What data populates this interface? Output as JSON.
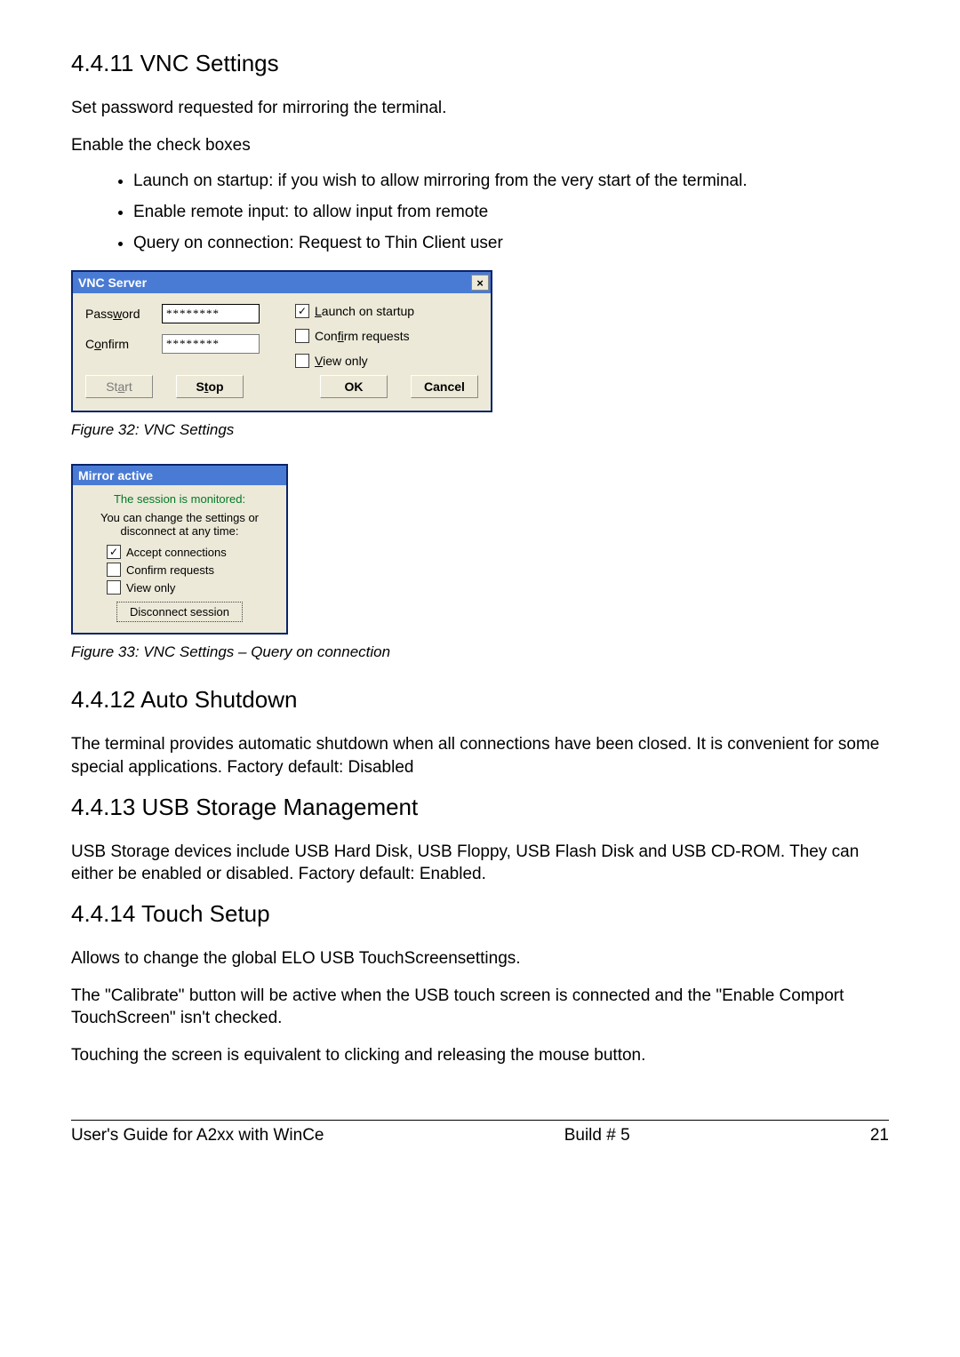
{
  "s1": {
    "heading": "4.4.11 VNC Settings",
    "p1": "Set password requested for mirroring the terminal.",
    "p2": "Enable the check boxes",
    "bullets": [
      "Launch on startup:    if you wish to allow mirroring from the very start of the terminal.",
      "Enable remote input: to allow input from remote",
      "Query on connection: Request to Thin Client user"
    ]
  },
  "vnc": {
    "title": "VNC Server",
    "close": "×",
    "password_label": "Password",
    "confirm_label": "Confirm",
    "password_value": "********",
    "confirm_value": "********",
    "cb_launch": "Launch on startup",
    "cb_confirm": "Confirm requests",
    "cb_view": "View only",
    "btn_start": "Start",
    "btn_stop": "Stop",
    "btn_ok": "OK",
    "btn_cancel": "Cancel"
  },
  "cap1": "Figure 32: VNC Settings",
  "mirror": {
    "title": "Mirror active",
    "line1": "The session is monitored:",
    "line2": "You can change the settings or disconnect at any time:",
    "cb_accept": "Accept connections",
    "cb_confirm": "Confirm requests",
    "cb_view": "View only",
    "btn_disconnect": "Disconnect session"
  },
  "cap2": "Figure 33: VNC Settings – Query on connection",
  "s2": {
    "heading": "4.4.12 Auto Shutdown",
    "p1": "The terminal provides automatic shutdown when all connections have been closed. It is convenient for some special applications. Factory default: Disabled"
  },
  "s3": {
    "heading": "4.4.13 USB Storage Management",
    "p1": "USB Storage devices include USB Hard Disk, USB Floppy, USB Flash Disk and USB CD-ROM. They can either be enabled or disabled. Factory default: Enabled."
  },
  "s4": {
    "heading": "4.4.14 Touch Setup",
    "p1": "Allows to change the global ELO USB TouchScreensettings.",
    "p2": "The \"Calibrate\" button will be active when the USB touch screen is connected and the \"Enable Comport TouchScreen\" isn't checked.",
    "p3": "Touching the screen is equivalent to clicking and releasing the mouse button."
  },
  "footer": {
    "left": "User's Guide for A2xx with WinCe",
    "center": "Build # 5",
    "right": "21"
  }
}
